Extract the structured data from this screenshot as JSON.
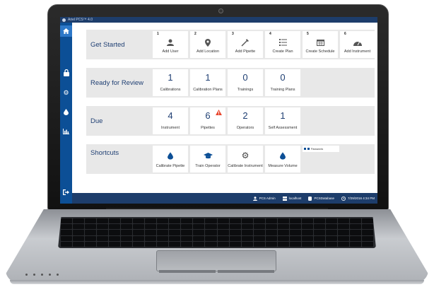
{
  "window": {
    "title": "Ariel PCS™ 4.0"
  },
  "sidebar": {
    "items": [
      {
        "icon": "home-icon"
      },
      {
        "icon": "lock-icon"
      },
      {
        "icon": "gear-icon"
      },
      {
        "icon": "drop-icon"
      },
      {
        "icon": "bar-chart-icon"
      },
      {
        "icon": "logout-icon"
      }
    ]
  },
  "get_started": {
    "title": "Get Started",
    "tiles": [
      {
        "num": "1",
        "label": "Add User",
        "icon": "user-icon"
      },
      {
        "num": "2",
        "label": "Add Location",
        "icon": "map-pin-icon"
      },
      {
        "num": "3",
        "label": "Add Pipette",
        "icon": "pipette-icon"
      },
      {
        "num": "4",
        "label": "Create Plan",
        "icon": "list-icon"
      },
      {
        "num": "5",
        "label": "Create Schedule",
        "icon": "calendar-icon"
      },
      {
        "num": "6",
        "label": "Add Instrument",
        "icon": "dashboard-icon"
      }
    ]
  },
  "ready_for_review": {
    "title": "Ready for Review",
    "tiles": [
      {
        "value": "1",
        "label": "Calibrations"
      },
      {
        "value": "1",
        "label": "Calibration Plans"
      },
      {
        "value": "0",
        "label": "Trainings"
      },
      {
        "value": "0",
        "label": "Training Plans"
      }
    ]
  },
  "due": {
    "title": "Due",
    "tiles": [
      {
        "value": "4",
        "label": "Instrument"
      },
      {
        "value": "6",
        "label": "Pipettes",
        "warning": true
      },
      {
        "value": "2",
        "label": "Operators"
      },
      {
        "value": "1",
        "label": "Self Assessment"
      }
    ]
  },
  "shortcuts": {
    "title": "Shortcuts",
    "tiles": [
      {
        "label": "Calibrate Pipette",
        "icon": "drop-icon"
      },
      {
        "label": "Train Operator",
        "icon": "graduation-cap-icon"
      },
      {
        "label": "Calibrate Instrument",
        "icon": "gear-icon"
      },
      {
        "label": "Measure Volume",
        "icon": "drop-icon"
      }
    ],
    "mini_card": {
      "label": "Passwords"
    }
  },
  "statusbar": {
    "user": "PCS Admin",
    "server": "localhost",
    "database": "PCSDatabase",
    "datetime": "7/29/2016 4:34 PM"
  },
  "colors": {
    "sidebar": "#0c4f96",
    "titlebar": "#1d3d6b",
    "row_bg": "#e8e8e8",
    "accent_text": "#1f3f73",
    "warning": "#e8452c"
  }
}
